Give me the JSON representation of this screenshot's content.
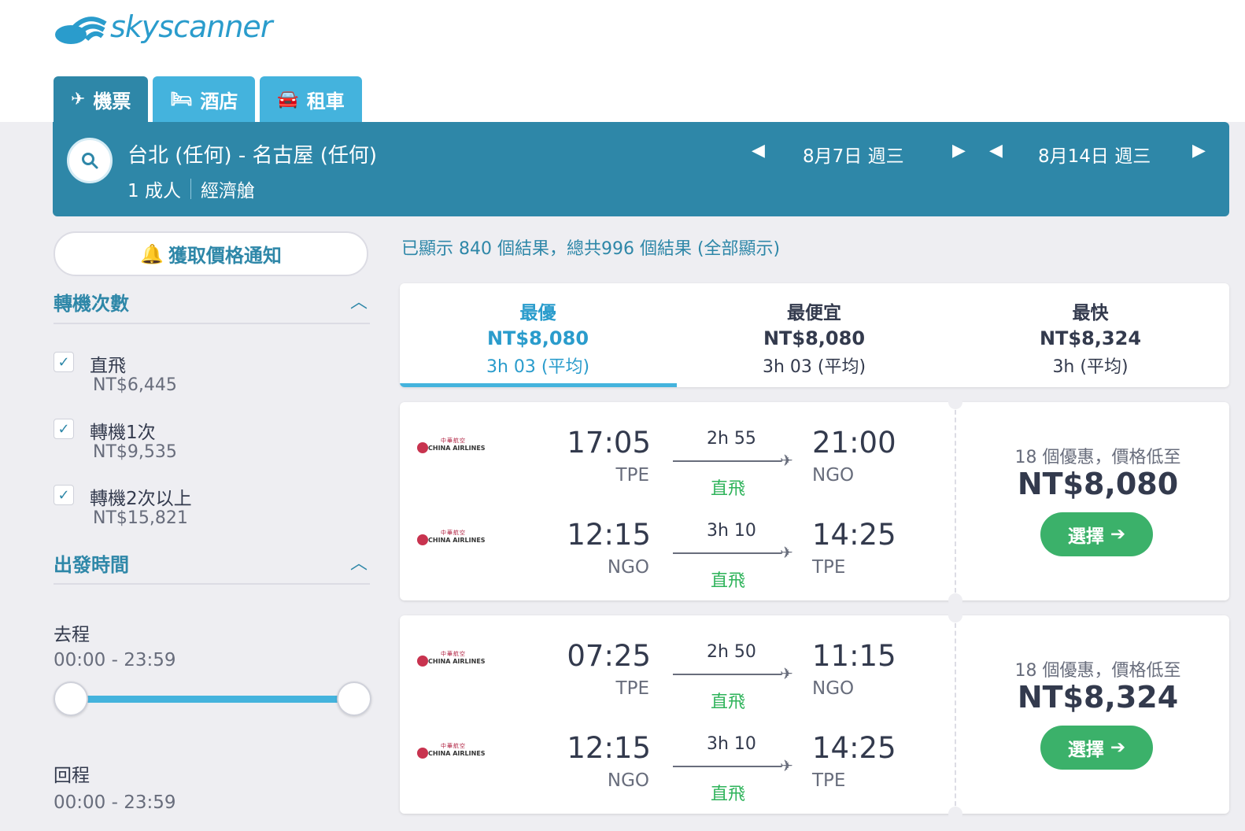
{
  "brand": {
    "name": "skyscanner",
    "color": "#2a9ccc"
  },
  "tabs": [
    {
      "label": "機票",
      "icon": "plane-icon",
      "active": true
    },
    {
      "label": "酒店",
      "icon": "bed-icon",
      "active": false
    },
    {
      "label": "租車",
      "icon": "car-icon",
      "active": false
    }
  ],
  "search": {
    "route": "台北 (任何) - 名古屋 (任何)",
    "passengers": "1 成人",
    "cabin": "經濟艙",
    "depart_date": "8月7日 週三",
    "return_date": "8月14日 週三"
  },
  "sidebar": {
    "price_alert_label": "獲取價格通知",
    "stops_title": "轉機次數",
    "stops": [
      {
        "label": "直飛",
        "price": "NT$6,445",
        "checked": true
      },
      {
        "label": "轉機1次",
        "price": "NT$9,535",
        "checked": true
      },
      {
        "label": "轉機2次以上",
        "price": "NT$15,821",
        "checked": true
      }
    ],
    "times_title": "出發時間",
    "outbound_label": "去程",
    "outbound_range": "00:00 - 23:59",
    "return_label": "回程",
    "return_range": "00:00 - 23:59"
  },
  "results": {
    "count_text": "已顯示 840 個結果，總共996 個結果 (全部顯示)",
    "sort_tabs": [
      {
        "label": "最優",
        "price": "NT$8,080",
        "duration": "3h 03 (平均)",
        "active": true
      },
      {
        "label": "最便宜",
        "price": "NT$8,080",
        "duration": "3h 03 (平均)",
        "active": false
      },
      {
        "label": "最快",
        "price": "NT$8,324",
        "duration": "3h (平均)",
        "active": false
      }
    ],
    "cards": [
      {
        "legs": [
          {
            "airline_cn": "中華航空",
            "airline_en": "CHINA AIRLINES",
            "dep_time": "17:05",
            "dep_airport": "TPE",
            "duration": "2h 55",
            "stops": "直飛",
            "arr_time": "21:00",
            "arr_airport": "NGO"
          },
          {
            "airline_cn": "中華航空",
            "airline_en": "CHINA AIRLINES",
            "dep_time": "12:15",
            "dep_airport": "NGO",
            "duration": "3h 10",
            "stops": "直飛",
            "arr_time": "14:25",
            "arr_airport": "TPE"
          }
        ],
        "deals_text": "18 個優惠，價格低至",
        "price": "NT$8,080",
        "select_label": "選擇"
      },
      {
        "legs": [
          {
            "airline_cn": "中華航空",
            "airline_en": "CHINA AIRLINES",
            "dep_time": "07:25",
            "dep_airport": "TPE",
            "duration": "2h 50",
            "stops": "直飛",
            "arr_time": "11:15",
            "arr_airport": "NGO"
          },
          {
            "airline_cn": "中華航空",
            "airline_en": "CHINA AIRLINES",
            "dep_time": "12:15",
            "dep_airport": "NGO",
            "duration": "3h 10",
            "stops": "直飛",
            "arr_time": "14:25",
            "arr_airport": "TPE"
          }
        ],
        "deals_text": "18 個優惠，價格低至",
        "price": "NT$8,324",
        "select_label": "選擇"
      }
    ]
  },
  "colors": {
    "primary": "#2e87a8",
    "accent": "#44b3dd",
    "direct": "#2eb35a",
    "select": "#3bb16a"
  }
}
